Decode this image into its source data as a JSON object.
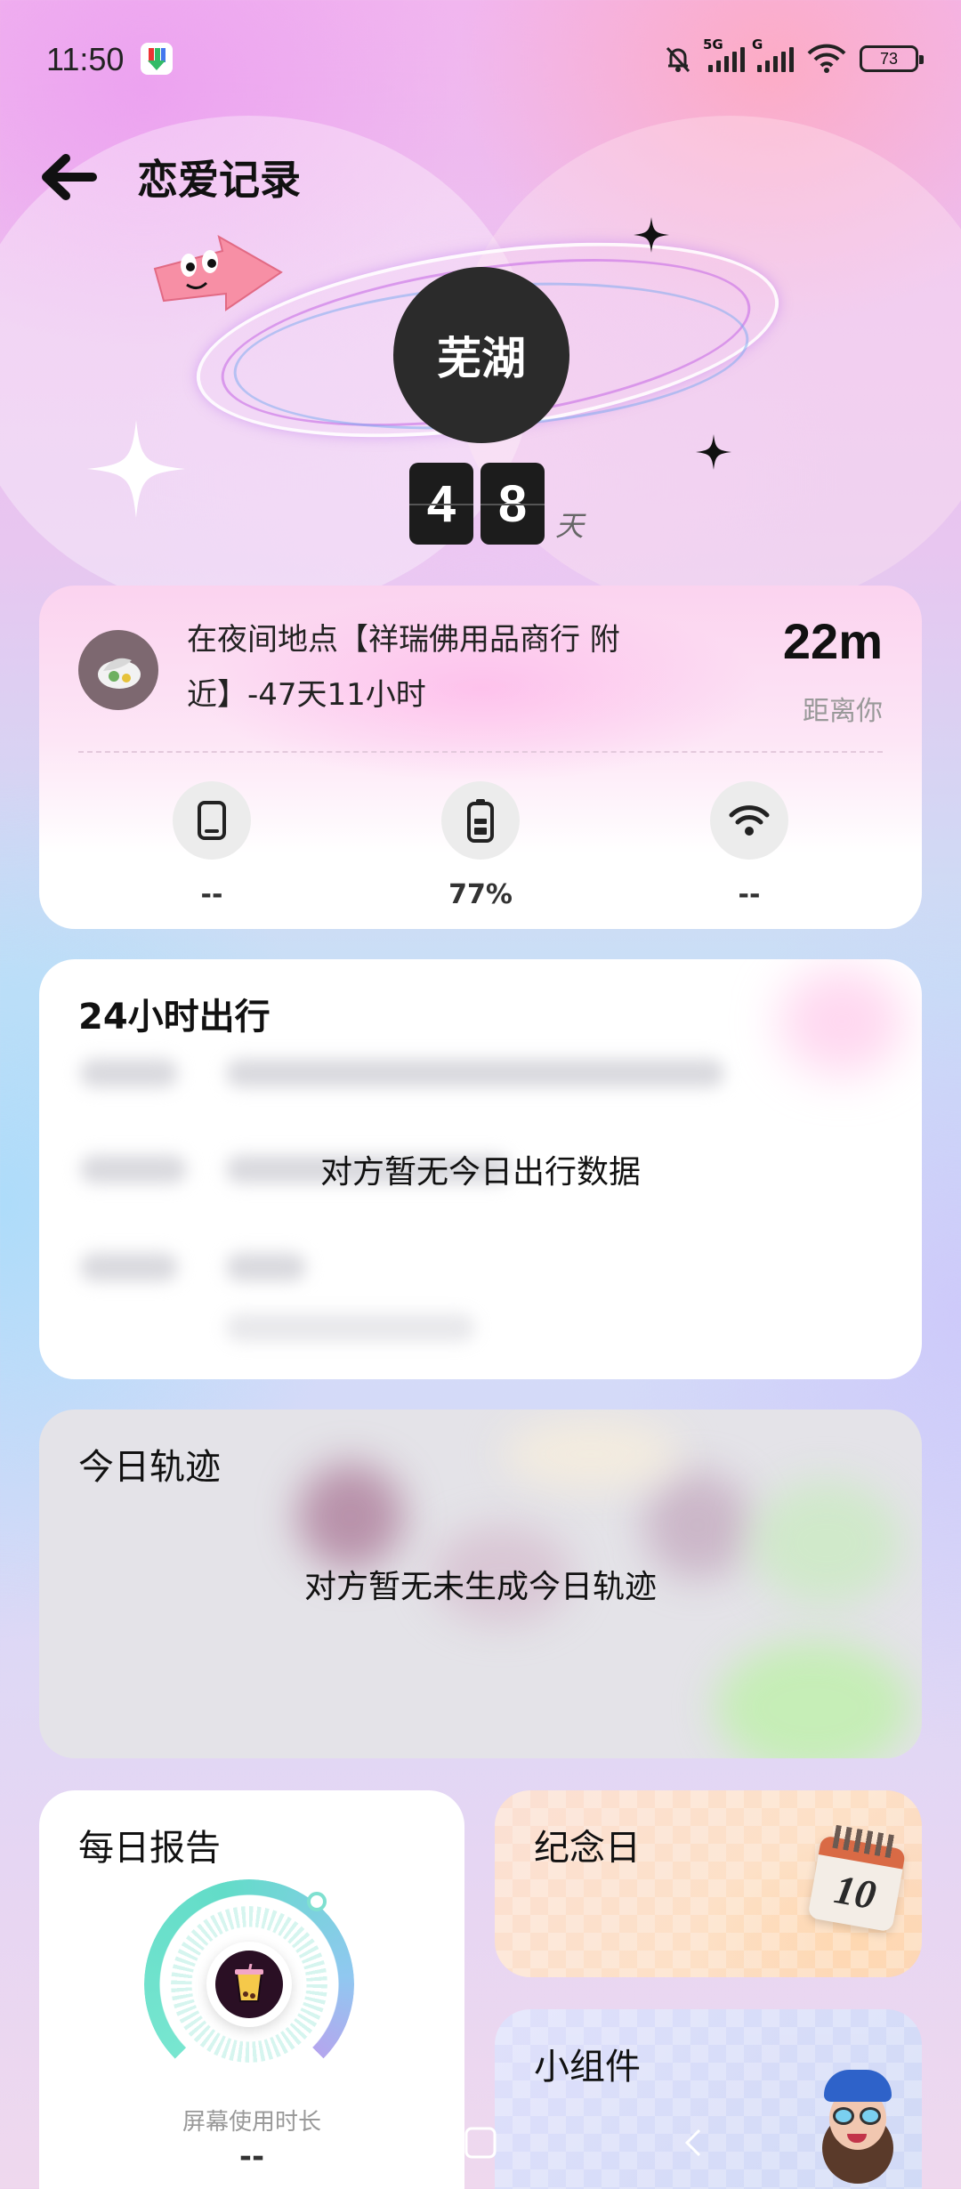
{
  "status_bar": {
    "time": "11:50",
    "network_1": "5G",
    "network_2": "G",
    "battery": "73"
  },
  "header": {
    "title": "恋爱记录",
    "back_icon": "arrow-left-icon"
  },
  "hero": {
    "city": "芜湖",
    "days_digits": [
      "4",
      "8"
    ],
    "days_unit": "天"
  },
  "location_card": {
    "status_text": "在夜间地点【祥瑞佛用品商行 附近】-47天11小时",
    "distance": "22m",
    "distance_label": "距离你",
    "stats": [
      {
        "icon": "phone-icon",
        "value": "--"
      },
      {
        "icon": "battery-icon",
        "value": "77%"
      },
      {
        "icon": "wifi-icon",
        "value": "--"
      }
    ]
  },
  "travel_card": {
    "title": "24小时出行",
    "empty_message": "对方暂无今日出行数据"
  },
  "track_card": {
    "title": "今日轨迹",
    "empty_message": "对方暂无未生成今日轨迹"
  },
  "report_card": {
    "title": "每日报告",
    "metric_label": "屏幕使用时长",
    "metric_value": "--"
  },
  "anniversary_card": {
    "title": "纪念日",
    "calendar_day": "10"
  },
  "widget_card": {
    "title": "小组件"
  },
  "colors": {
    "accent_dark": "#2b2b2b",
    "gauge_teal": "#62dcc8",
    "gauge_purple": "#b4a6ee"
  }
}
